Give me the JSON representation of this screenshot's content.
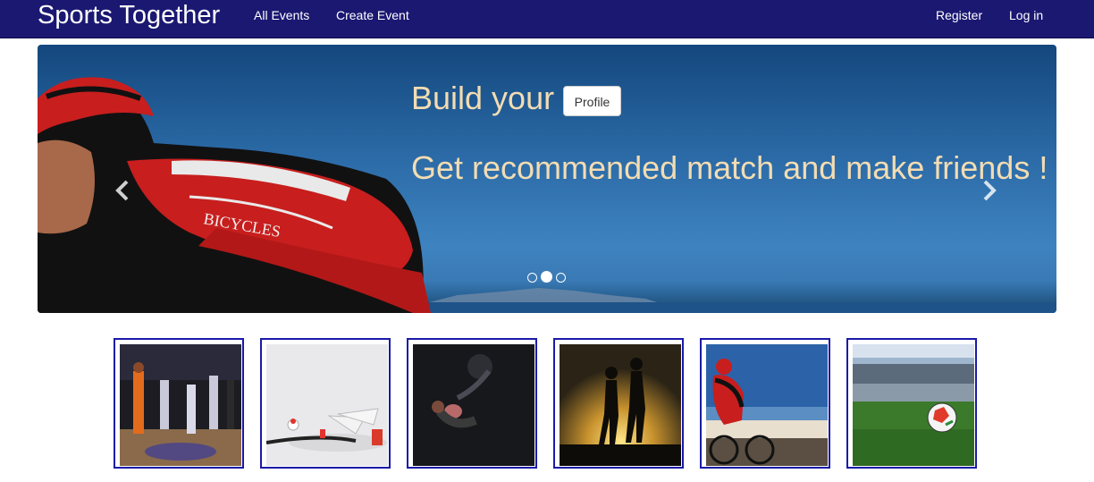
{
  "navbar": {
    "brand": "Sports Together",
    "links": {
      "all_events": "All Events",
      "create_event": "Create Event"
    },
    "right": {
      "register": "Register",
      "login": "Log in"
    },
    "background_color": "#1b1872"
  },
  "carousel": {
    "title": "Build your",
    "profile_button": "Profile",
    "subtitle": "Get recommended match and make friends !",
    "caption_color": "#f3dcb2",
    "prev_icon": "chevron-left-icon",
    "next_icon": "chevron-right-icon",
    "slide_count": 3,
    "active_slide": 2
  },
  "thumbnails": [
    {
      "subject": "basketball"
    },
    {
      "subject": "badminton"
    },
    {
      "subject": "gym"
    },
    {
      "subject": "running"
    },
    {
      "subject": "cycling"
    },
    {
      "subject": "soccer"
    }
  ],
  "colors": {
    "thumbnail_border": "#1a1aa8"
  }
}
